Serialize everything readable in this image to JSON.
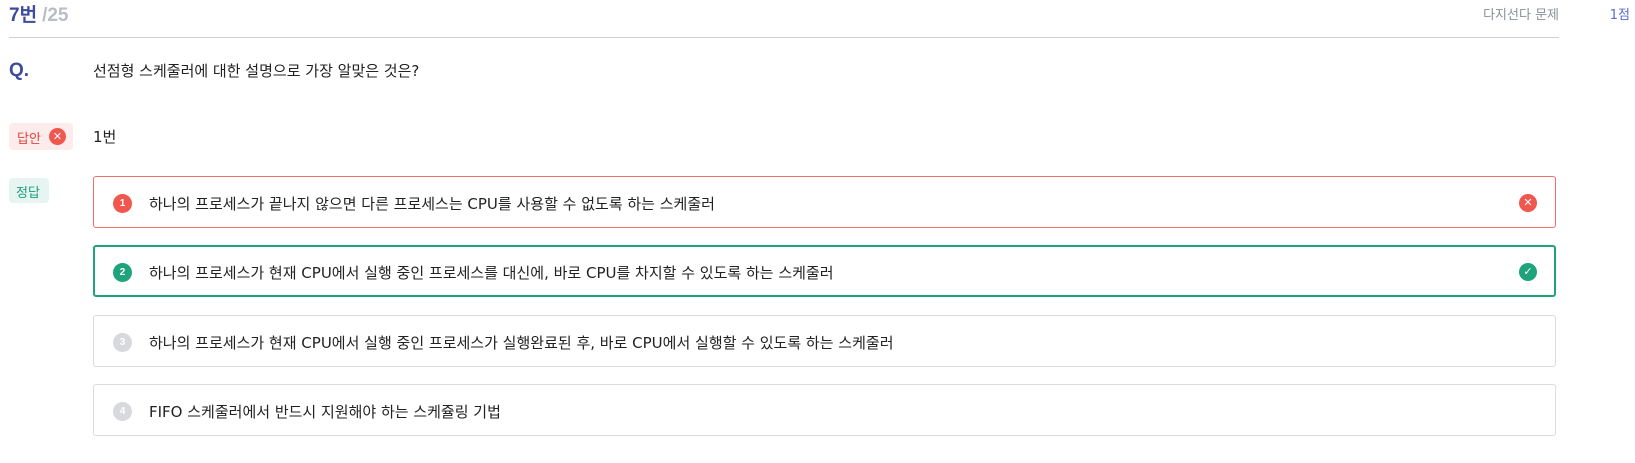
{
  "header": {
    "question_number": "7번",
    "question_total": "/25",
    "question_type": "다지선다 문제",
    "points": "1점"
  },
  "question": {
    "label": "Q.",
    "text": "선점형 스케줄러에 대한 설명으로 가장 알맞은 것은?"
  },
  "answer": {
    "label": "답안",
    "value": "1번",
    "status_icon": "x-circle-icon"
  },
  "correct": {
    "label": "정답"
  },
  "choices": [
    {
      "number": "1",
      "text": "하나의 프로세스가 끝나지 않으면 다른 프로세스는 CPU를 사용할 수 없도록 하는 스케줄러",
      "state": "wrong",
      "icon": "✕"
    },
    {
      "number": "2",
      "text": "하나의 프로세스가 현재 CPU에서 실행 중인 프로세스를 대신에, 바로 CPU를 차지할 수 있도록 하는 스케줄러",
      "state": "right",
      "icon": "✓"
    },
    {
      "number": "3",
      "text": "하나의 프로세스가 현재 CPU에서 실행 중인 프로세스가 실행완료된 후, 바로 CPU에서 실행할 수 있도록 하는 스케줄러",
      "state": "neutral",
      "icon": ""
    },
    {
      "number": "4",
      "text": "FIFO 스케줄러에서 반드시 지원해야 하는 스케쥴링 기법",
      "state": "neutral",
      "icon": ""
    }
  ],
  "colors": {
    "accent": "#3d4a9e",
    "wrong": "#f0574e",
    "correct": "#1ea37d"
  }
}
